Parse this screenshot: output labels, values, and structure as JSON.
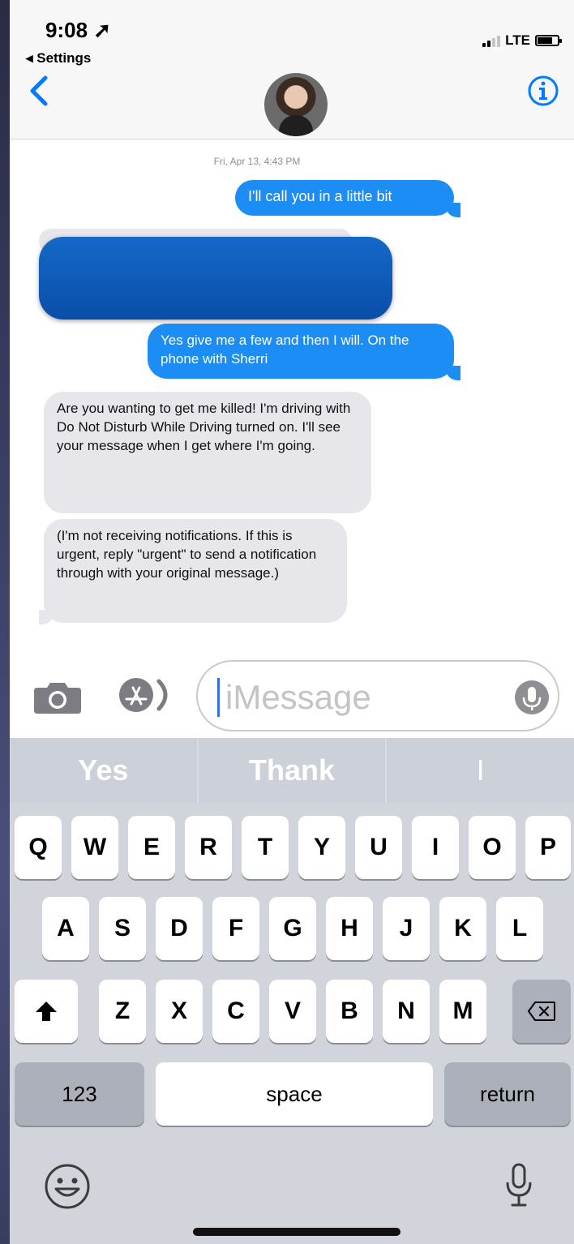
{
  "status_bar": {
    "time": "9:08",
    "back_app": "◂ Settings",
    "network": "LTE",
    "signal_bars": 2,
    "battery_level": 0.7
  },
  "header": {
    "back_icon": "chevron-left-icon",
    "avatar": "contact-avatar",
    "info_icon": "info-icon"
  },
  "conversation": {
    "timestamp": "Fri, Apr 13, 4:43 PM",
    "messages": [
      {
        "direction": "outgoing",
        "text": "I'll call you in a little bit"
      },
      {
        "direction": "incoming",
        "text": "",
        "redacted": true
      },
      {
        "direction": "outgoing",
        "text": "Yes give me a few and then I will. On the phone with Sherri"
      },
      {
        "direction": "incoming",
        "text": "Are you wanting to get me killed! I'm driving with Do Not Disturb While Driving turned on. I'll see your message when I get where I'm going."
      },
      {
        "direction": "incoming",
        "text": "(I'm not receiving notifications. If this is urgent, reply \"urgent\" to send a notification through with your original message.)"
      }
    ]
  },
  "composer": {
    "placeholder": "iMessage",
    "camera_icon": "camera-icon",
    "apps_icon": "app-store-icon",
    "audio_icon": "audio-record-icon"
  },
  "keyboard": {
    "predictions": [
      "Yes",
      "Thank",
      "I"
    ],
    "row1": [
      "Q",
      "W",
      "E",
      "R",
      "T",
      "Y",
      "U",
      "I",
      "O",
      "P"
    ],
    "row2": [
      "A",
      "S",
      "D",
      "F",
      "G",
      "H",
      "J",
      "K",
      "L"
    ],
    "row3": [
      "Z",
      "X",
      "C",
      "V",
      "B",
      "N",
      "M"
    ],
    "numbers_label": "123",
    "space_label": "space",
    "return_label": "return",
    "shift_icon": "shift-icon",
    "delete_icon": "delete-icon",
    "emoji_icon": "emoji-icon",
    "dictation_icon": "microphone-icon"
  },
  "colors": {
    "outgoing_bubble": "#1d8df6",
    "incoming_bubble": "#e6e6eb",
    "accent": "#007aff",
    "redaction": "#0a4ea8"
  }
}
